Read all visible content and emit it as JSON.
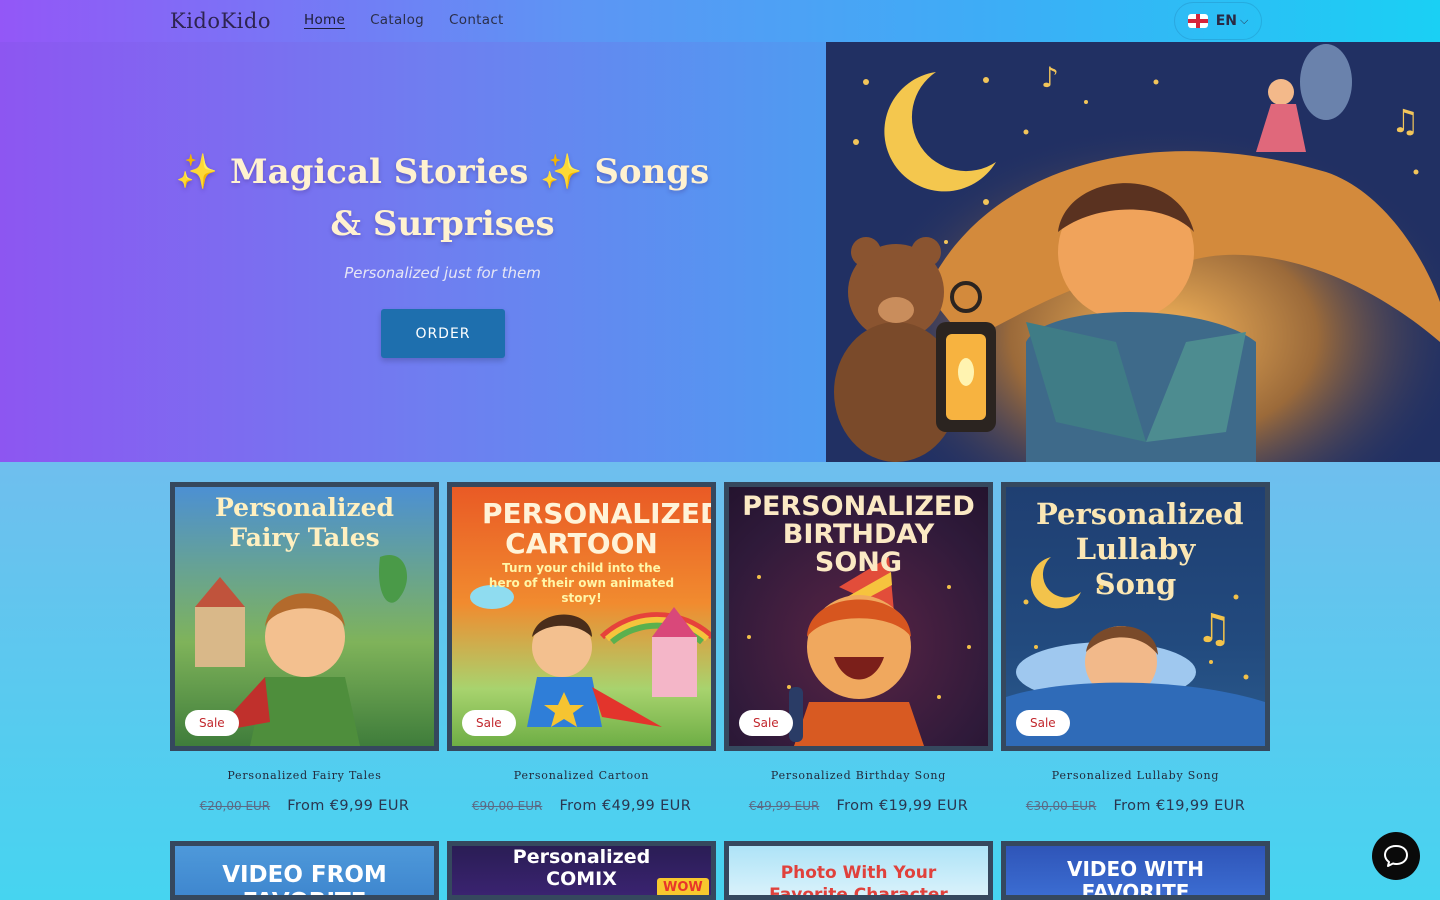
{
  "header": {
    "logo": "KidoKido",
    "nav": [
      "Home",
      "Catalog",
      "Contact"
    ],
    "lang": "EN"
  },
  "hero": {
    "title": "✨ Magical Stories ✨ Songs & Surprises",
    "subtitle": "Personalized just for them",
    "cta": "ORDER"
  },
  "products": [
    {
      "name": "Personalized Fairy Tales",
      "old_price": "€20,00 EUR",
      "price": "From €9,99 EUR",
      "badge": "Sale",
      "art_text": "Personalized Fairy Tales"
    },
    {
      "name": "Personalized Cartoon",
      "old_price": "€90,00 EUR",
      "price": "From €49,99 EUR",
      "badge": "Sale",
      "art_text": "PERSONALIZED CARTOON",
      "art_sub": "Turn your child into the hero of their own animated story!"
    },
    {
      "name": "Personalized Birthday Song",
      "old_price": "€49,99 EUR",
      "price": "From €19,99 EUR",
      "badge": "Sale",
      "art_text": "PERSONALIZED BIRTHDAY SONG"
    },
    {
      "name": "Personalized Lullaby Song",
      "old_price": "€30,00 EUR",
      "price": "From €19,99 EUR",
      "badge": "Sale",
      "art_text": "Personalized Lullaby Song"
    }
  ],
  "products_row2": [
    {
      "art_text": "VIDEO FROM FAVORITE CHARACTER"
    },
    {
      "art_text": "Personalized COMIX",
      "art_badge": "WOW"
    },
    {
      "art_text": "Photo With Your Favorite Character"
    },
    {
      "art_text": "VIDEO WITH FAVORITE CHARACTER"
    }
  ],
  "colors": {
    "header_start": "#9357f7",
    "header_end": "#1ad0f4",
    "order_button": "#1e6fae",
    "sale_text": "#c2272d",
    "card_border": "#35485e"
  }
}
